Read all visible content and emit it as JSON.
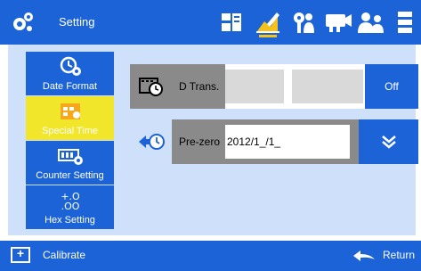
{
  "header": {
    "title": "Setting",
    "icons": [
      "display-settings-icon",
      "edit-settings-icon",
      "key-user-icon",
      "projector-icon",
      "users-icon",
      "server-icon"
    ],
    "active_icon": "edit-settings-icon"
  },
  "menu": {
    "items": [
      {
        "label": "Date Format",
        "icon": "clock-gear-icon",
        "active": false
      },
      {
        "label": "Special Time",
        "icon": "special-time-icon",
        "active": true
      },
      {
        "label": "Counter Setting",
        "icon": "counter-gear-icon",
        "active": false
      },
      {
        "label": "Hex Setting",
        "icon": "hex-icon",
        "active": false
      }
    ]
  },
  "rows": {
    "d_trans": {
      "label": "D Trans.",
      "toggle_label": "Off"
    },
    "pre_zero": {
      "label": "Pre-zero",
      "value": "2012/1_/1_"
    }
  },
  "footer": {
    "calibrate_label": "Calibrate",
    "return_label": "Return"
  },
  "colors": {
    "primary": "#1b63d6",
    "active": "#f2e62b",
    "panel": "#cfe0fb",
    "grey": "#8a8a8a"
  }
}
